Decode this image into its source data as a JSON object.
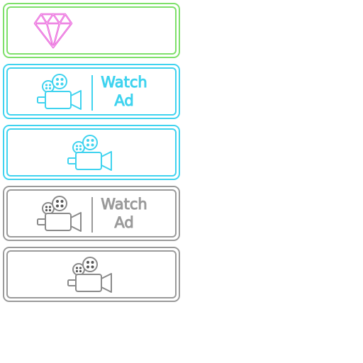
{
  "colors": {
    "green": "#7ee06a",
    "cyan": "#3fd3ef",
    "gray": "#9a9a9a",
    "pink": "#e552d6"
  },
  "buttons": [
    {
      "variant": "gem",
      "color": "green",
      "icon": "diamond-icon"
    },
    {
      "variant": "watch-ad-labeled",
      "color": "cyan",
      "icon": "movie-camera-icon",
      "label_line1": "Watch",
      "label_line2": "Ad"
    },
    {
      "variant": "watch-ad-icon",
      "color": "cyan",
      "icon": "movie-camera-icon"
    },
    {
      "variant": "watch-ad-labeled",
      "color": "gray",
      "icon": "movie-camera-icon",
      "label_line1": "Watch",
      "label_line2": "Ad"
    },
    {
      "variant": "watch-ad-icon",
      "color": "gray",
      "icon": "movie-camera-icon"
    }
  ]
}
